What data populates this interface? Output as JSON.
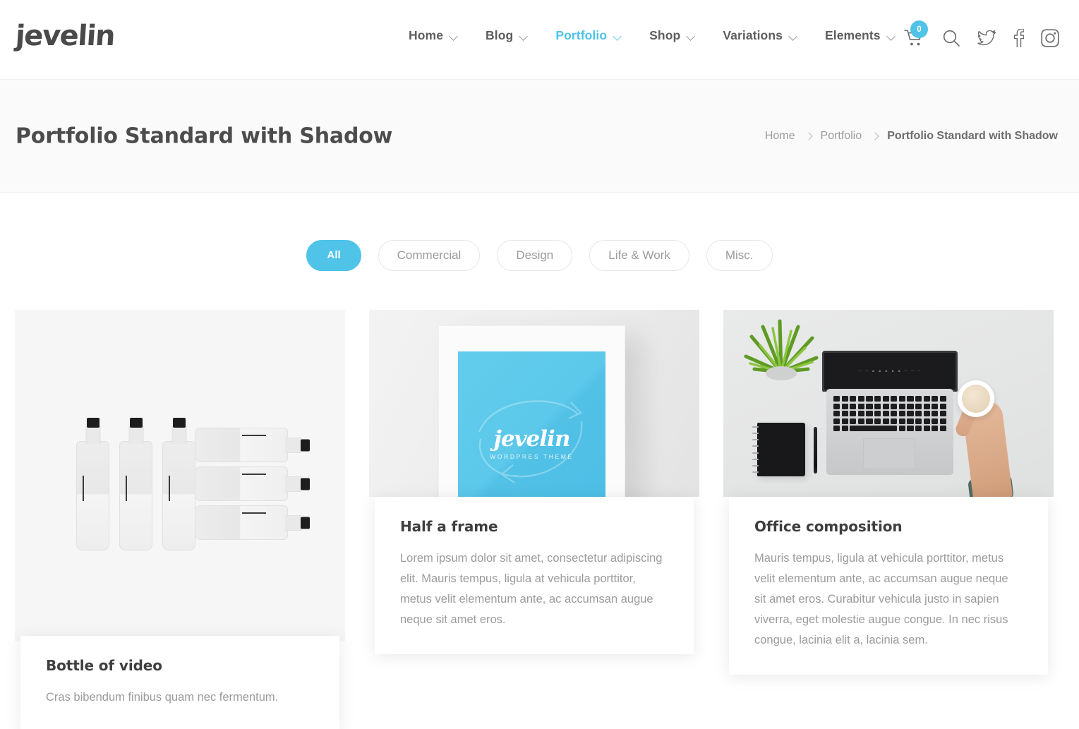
{
  "brand": {
    "logo_text": "jevelin",
    "accent_color": "#4fc3e8"
  },
  "nav": {
    "items": [
      {
        "label": "Home",
        "has_dropdown": true,
        "active": false
      },
      {
        "label": "Blog",
        "has_dropdown": true,
        "active": false
      },
      {
        "label": "Portfolio",
        "has_dropdown": true,
        "active": true
      },
      {
        "label": "Shop",
        "has_dropdown": true,
        "active": false
      },
      {
        "label": "Variations",
        "has_dropdown": true,
        "active": false
      },
      {
        "label": "Elements",
        "has_dropdown": true,
        "active": false
      }
    ],
    "icons": [
      {
        "name": "cart-icon",
        "badge": "0"
      },
      {
        "name": "search-icon"
      },
      {
        "name": "twitter-icon"
      },
      {
        "name": "facebook-icon"
      },
      {
        "name": "instagram-icon"
      }
    ],
    "cart_count": "0"
  },
  "page_header": {
    "title": "Portfolio Standard with Shadow",
    "breadcrumb": [
      {
        "label": "Home",
        "current": false
      },
      {
        "label": "Portfolio",
        "current": false
      },
      {
        "label": "Portfolio Standard with Shadow",
        "current": true
      }
    ]
  },
  "filters": [
    {
      "label": "All",
      "active": true
    },
    {
      "label": "Commercial",
      "active": false
    },
    {
      "label": "Design",
      "active": false
    },
    {
      "label": "Life & Work",
      "active": false
    },
    {
      "label": "Misc.",
      "active": false
    }
  ],
  "projects": [
    {
      "title": "Bottle of video",
      "description": "Cras bibendum finibus quam nec fermentum.",
      "image_alt": "Six white product bottles, three standing and three lying down, on a light grey background"
    },
    {
      "title": "Half a frame",
      "description": "Lorem ipsum dolor sit amet, consectetur adipiscing elit. Mauris tempus, ligula at vehicula porttitor, metus velit elementum ante, ac accumsan augue neque sit amet eros.",
      "image_alt": "White picture frame holding a cyan poster with the jevelin logo",
      "poster": {
        "logo": "jevelin",
        "subtitle": "WORDPRES THEME",
        "background": "#53c2e7"
      }
    },
    {
      "title": "Office composition",
      "description": "Mauris tempus, ligula at vehicula porttitor, metus velit elementum ante, ac accumsan augue neque sit amet eros. Curabitur vehicula justo in sapien viverra, eget molestie augue congue. In nec risus congue, lacinia elit a, lacinia sem.",
      "image_alt": "Flat lay of a laptop, plant, notebook, pen and a hand holding a coffee cup"
    }
  ]
}
